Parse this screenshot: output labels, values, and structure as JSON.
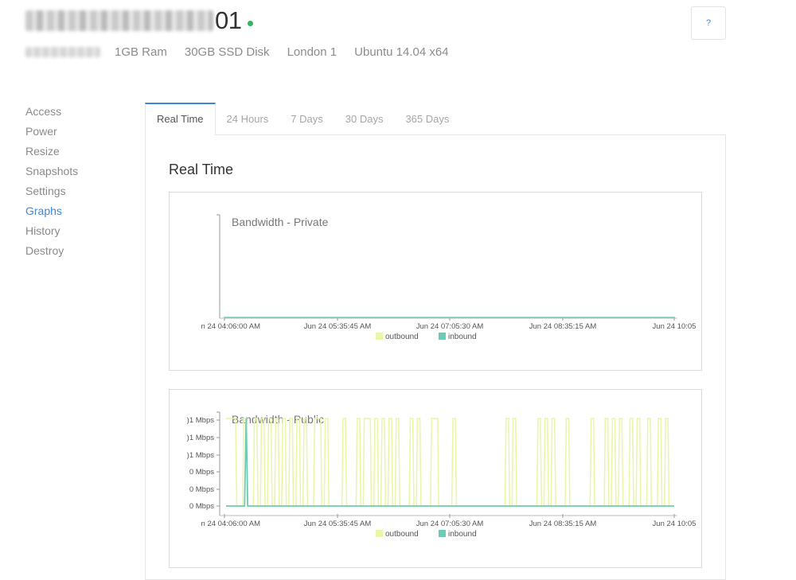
{
  "droplet": {
    "name_suffix": "01",
    "specs": [
      "1GB Ram",
      "30GB SSD Disk",
      "London 1",
      "Ubuntu 14.04 x64"
    ]
  },
  "help": {
    "label": "?"
  },
  "sidebar": {
    "items": [
      {
        "label": "Access"
      },
      {
        "label": "Power"
      },
      {
        "label": "Resize"
      },
      {
        "label": "Snapshots"
      },
      {
        "label": "Settings"
      },
      {
        "label": "Graphs",
        "active": true
      },
      {
        "label": "History"
      },
      {
        "label": "Destroy"
      }
    ]
  },
  "tabs": [
    {
      "label": "Real Time",
      "active": true
    },
    {
      "label": "24 Hours"
    },
    {
      "label": "7 Days"
    },
    {
      "label": "30 Days"
    },
    {
      "label": "365 Days"
    }
  ],
  "panel": {
    "heading": "Real Time"
  },
  "colors": {
    "accent": "#3b87d6",
    "status_online": "#2fb463",
    "outbound": "#e9f5a7",
    "inbound": "#6ecbb3"
  },
  "chart_data": [
    {
      "type": "line",
      "title": "Bandwidth - Private",
      "x_ticks": [
        "n 24 04:06:00 AM",
        "Jun 24 05:35:45 AM",
        "Jun 24 07:05:30 AM",
        "Jun 24 08:35:15 AM",
        "Jun 24 10:05"
      ],
      "y_ticks": [],
      "legend": [
        "outbound",
        "inbound"
      ],
      "series": [
        {
          "name": "outbound",
          "values": [
            0,
            0
          ]
        },
        {
          "name": "inbound",
          "values": [
            0,
            0
          ]
        }
      ]
    },
    {
      "type": "line",
      "title": "Bandwidth - Public",
      "x_ticks": [
        "n 24 04:06:00 AM",
        "Jun 24 05:35:45 AM",
        "Jun 24 07:05:30 AM",
        "Jun 24 08:35:15 AM",
        "Jun 24 10:05"
      ],
      "y_ticks": [
        "0 Mbps",
        "0 Mbps",
        "0 Mbps",
        ")1 Mbps",
        ")1 Mbps",
        ")1 Mbps"
      ],
      "legend": [
        "outbound",
        "inbound"
      ],
      "ymax": 5,
      "outbound_pulses": [
        0,
        1,
        2,
        5,
        8,
        10,
        12,
        14,
        16,
        18,
        20,
        22,
        25,
        26,
        28,
        33,
        37,
        39,
        40,
        42,
        44,
        46,
        48,
        52,
        54,
        58,
        59,
        64,
        79,
        81,
        88,
        90,
        92,
        96,
        103,
        107,
        109,
        111,
        114,
        116,
        119,
        122,
        124
      ],
      "pulse_count": 126,
      "inbound_spike": 5
    }
  ]
}
